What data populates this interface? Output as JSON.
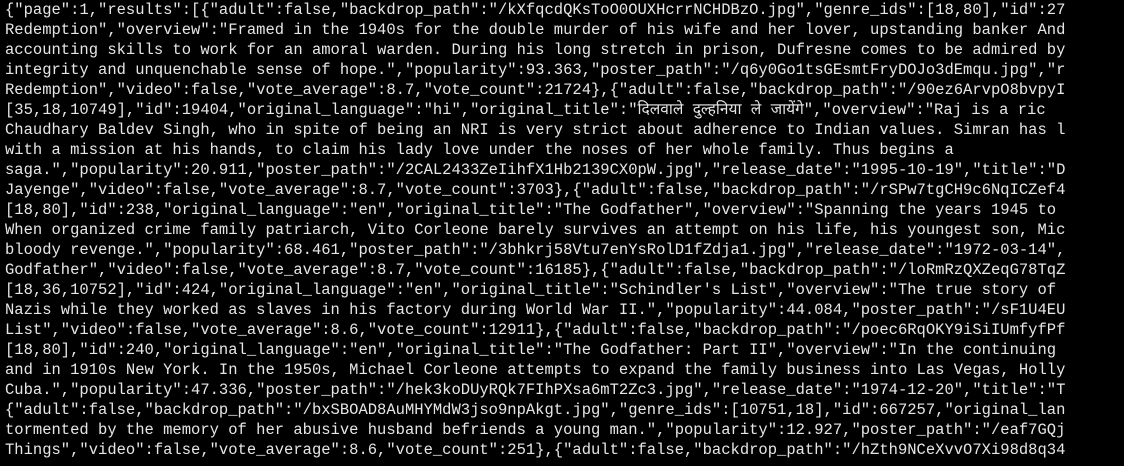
{
  "window": {
    "background_color": "#000000",
    "text_color": "#e6e6e6"
  },
  "lines": [
    "{\"page\":1,\"results\":[{\"adult\":false,\"backdrop_path\":\"/kXfqcdQKsToO0OUXHcrrNCHDBzO.jpg\",\"genre_ids\":[18,80],\"id\":27",
    "Redemption\",\"overview\":\"Framed in the 1940s for the double murder of his wife and her lover, upstanding banker And",
    "accounting skills to work for an amoral warden. During his long stretch in prison, Dufresne comes to be admired by",
    "integrity and unquenchable sense of hope.\",\"popularity\":93.363,\"poster_path\":\"/q6y0Go1tsGEsmtFryDOJo3dEmqu.jpg\",\"r",
    "Redemption\",\"video\":false,\"vote_average\":8.7,\"vote_count\":21724},{\"adult\":false,\"backdrop_path\":\"/90ez6ArvpO8bvpyI",
    "[35,18,10749],\"id\":19404,\"original_language\":\"hi\",\"original_title\":\"दिलवाले दुल्हनिया ले जायेंगे\",\"overview\":\"Raj is a ric",
    "Chaudhary Baldev Singh, who in spite of being an NRI is very strict about adherence to Indian values. Simran has l",
    "with a mission at his hands, to claim his lady love under the noses of her whole family. Thus begins a",
    "saga.\",\"popularity\":20.911,\"poster_path\":\"/2CAL2433ZeIihfX1Hb2139CX0pW.jpg\",\"release_date\":\"1995-10-19\",\"title\":\"D",
    "Jayenge\",\"video\":false,\"vote_average\":8.7,\"vote_count\":3703},{\"adult\":false,\"backdrop_path\":\"/rSPw7tgCH9c6NqICZef4",
    "[18,80],\"id\":238,\"original_language\":\"en\",\"original_title\":\"The Godfather\",\"overview\":\"Spanning the years 1945 to",
    "When organized crime family patriarch, Vito Corleone barely survives an attempt on his life, his youngest son, Mic",
    "bloody revenge.\",\"popularity\":68.461,\"poster_path\":\"/3bhkrj58Vtu7enYsRolD1fZdja1.jpg\",\"release_date\":\"1972-03-14\",",
    "Godfather\",\"video\":false,\"vote_average\":8.7,\"vote_count\":16185},{\"adult\":false,\"backdrop_path\":\"/loRmRzQXZeqG78TqZ",
    "[18,36,10752],\"id\":424,\"original_language\":\"en\",\"original_title\":\"Schindler's List\",\"overview\":\"The true story of",
    "Nazis while they worked as slaves in his factory during World War II.\",\"popularity\":44.084,\"poster_path\":\"/sF1U4EU",
    "List\",\"video\":false,\"vote_average\":8.6,\"vote_count\":12911},{\"adult\":false,\"backdrop_path\":\"/poec6RqOKY9iSiIUmfyfPf",
    "[18,80],\"id\":240,\"original_language\":\"en\",\"original_title\":\"The Godfather: Part II\",\"overview\":\"In the continuing",
    "and in 1910s New York. In the 1950s, Michael Corleone attempts to expand the family business into Las Vegas, Holly",
    "Cuba.\",\"popularity\":47.336,\"poster_path\":\"/hek3koDUyRQk7FIhPXsa6mT2Zc3.jpg\",\"release_date\":\"1974-12-20\",\"title\":\"T",
    "{\"adult\":false,\"backdrop_path\":\"/bxSBOAD8AuMHYMdW3jso9npAkgt.jpg\",\"genre_ids\":[10751,18],\"id\":667257,\"original_lan",
    "tormented by the memory of her abusive husband befriends a young man.\",\"popularity\":12.927,\"poster_path\":\"/eaf7GQj",
    "Things\",\"video\":false,\"vote_average\":8.6,\"vote_count\":251},{\"adult\":false,\"backdrop_path\":\"/hZth9NCeXvvO7Xi98d8q34"
  ]
}
